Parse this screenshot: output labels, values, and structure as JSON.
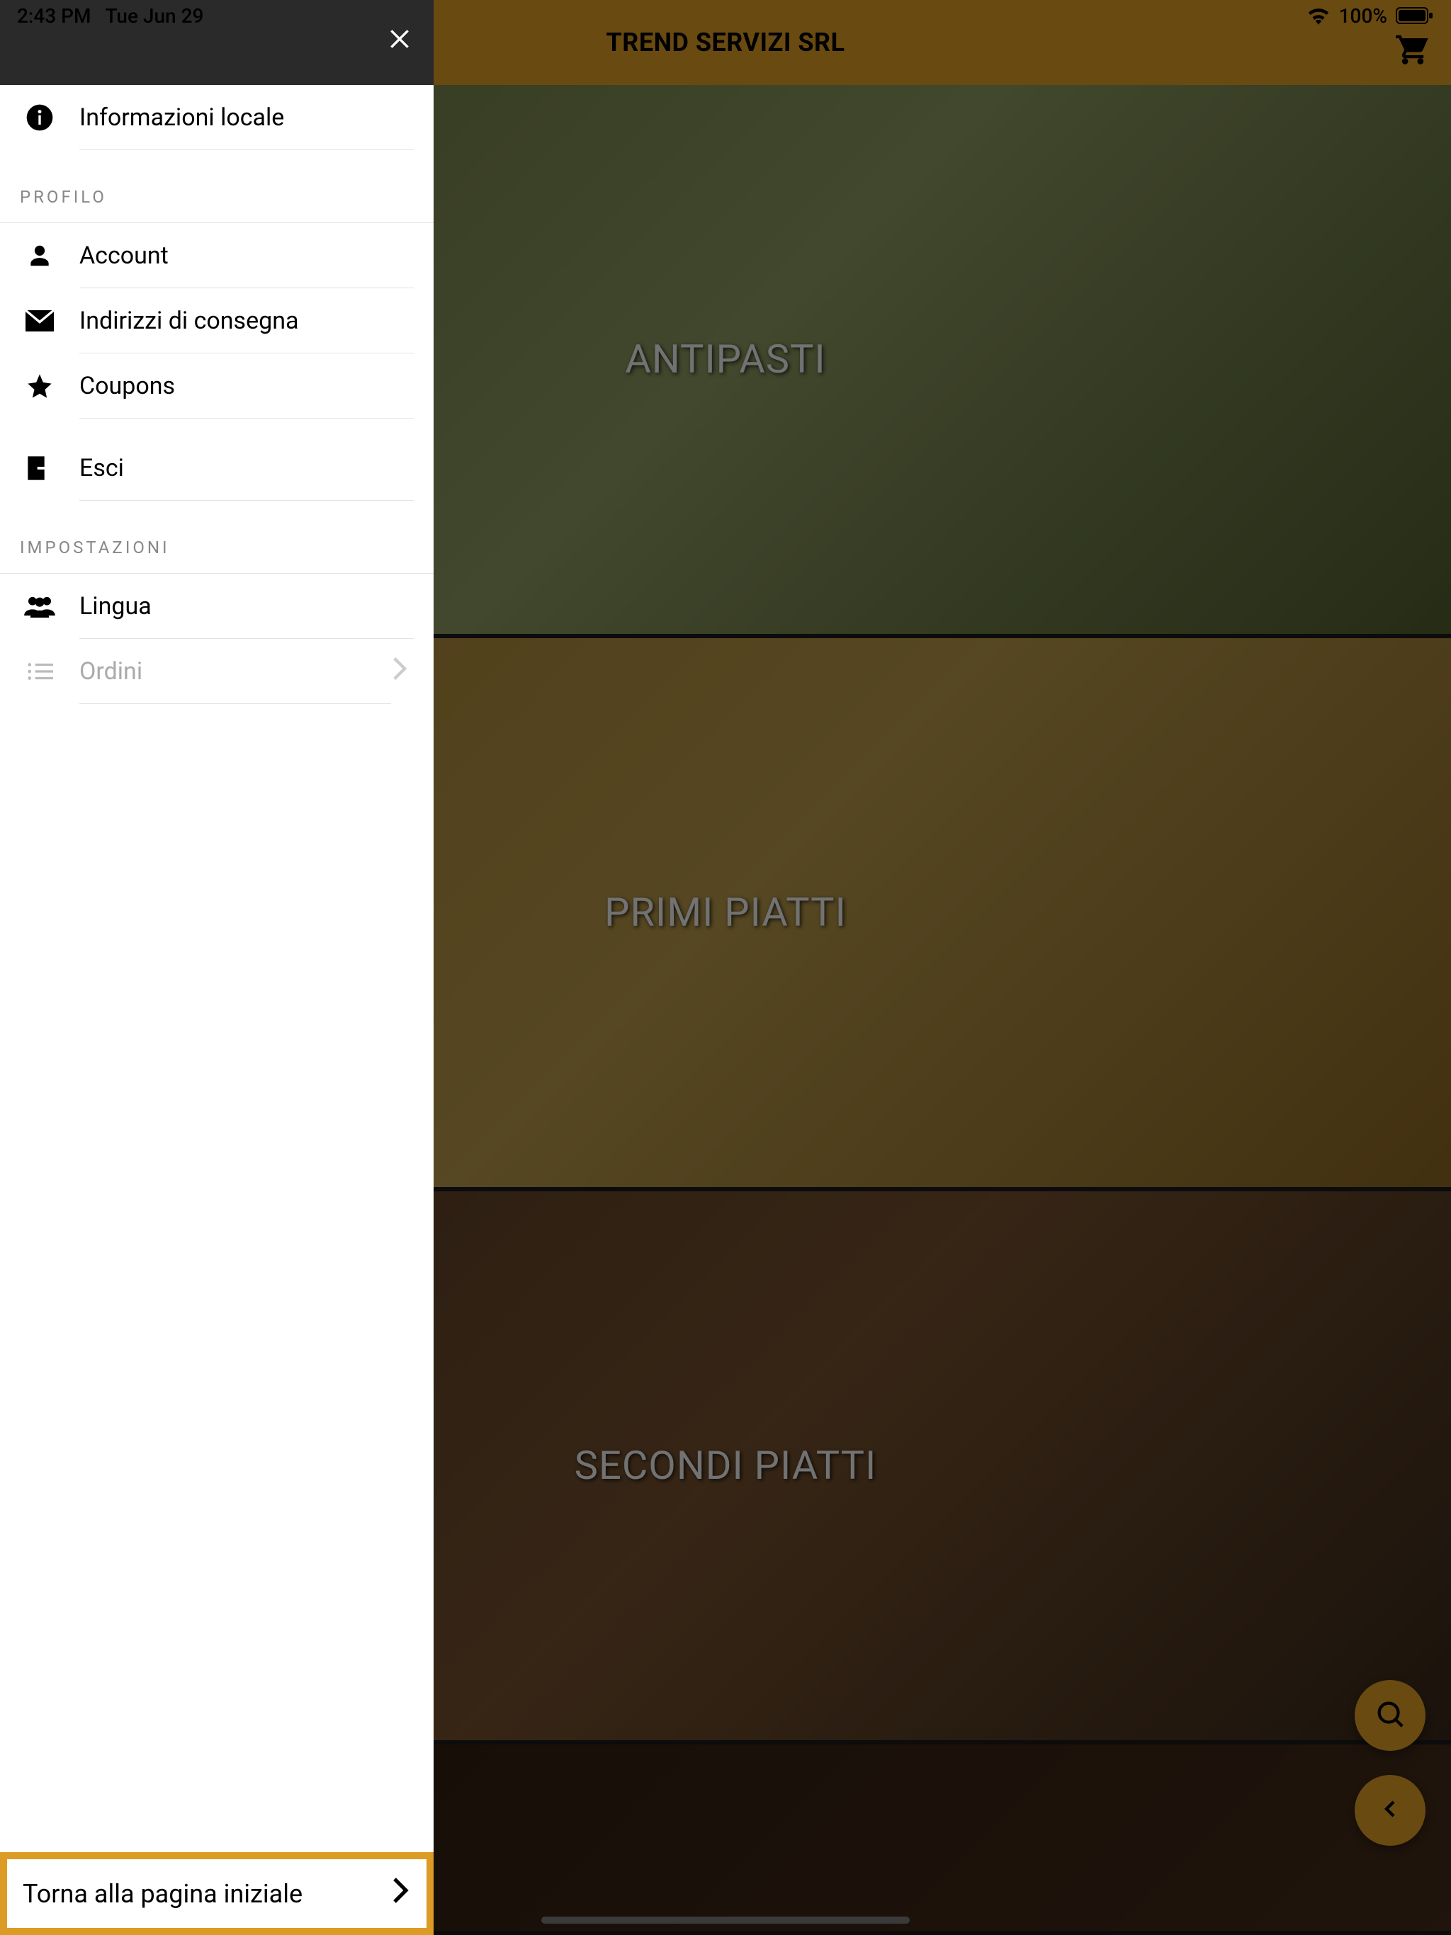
{
  "status_bar": {
    "time": "2:43 PM",
    "date": "Tue Jun 29",
    "battery_pct": "100%"
  },
  "header": {
    "title": "TREND SERVIZI SRL"
  },
  "sidebar": {
    "items": {
      "info": "Informazioni locale",
      "section_profile": "PROFILO",
      "account": "Account",
      "addresses": "Indirizzi di consegna",
      "coupons": "Coupons",
      "logout": "Esci",
      "section_settings": "IMPOSTAZIONI",
      "language": "Lingua",
      "orders": "Ordini"
    },
    "footer_button": "Torna alla pagina iniziale"
  },
  "categories": [
    {
      "label": "ANTIPASTI"
    },
    {
      "label": "PRIMI PIATTI"
    },
    {
      "label": "SECONDI PIATTI"
    }
  ]
}
